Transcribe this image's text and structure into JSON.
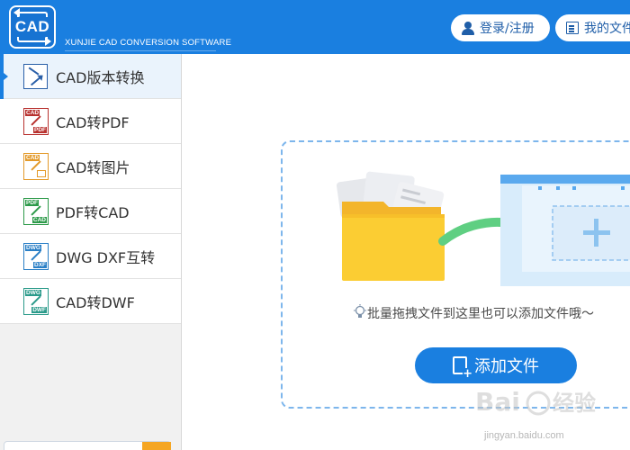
{
  "app": {
    "logo_text": "CAD",
    "tagline": "XUNJIE CAD CONVERSION SOFTWARE",
    "brand_color": "#1a7fe0"
  },
  "header": {
    "login_label": "登录/注册",
    "files_label": "我的文件"
  },
  "sidebar": {
    "items": [
      {
        "label": "CAD版本转换",
        "icon": "cad-version-convert-icon",
        "active": true
      },
      {
        "label": "CAD转PDF",
        "icon": "cad-to-pdf-icon",
        "active": false
      },
      {
        "label": "CAD转图片",
        "icon": "cad-to-image-icon",
        "active": false
      },
      {
        "label": "PDF转CAD",
        "icon": "pdf-to-cad-icon",
        "active": false
      },
      {
        "label": "DWG DXF互转",
        "icon": "dwg-dxf-convert-icon",
        "active": false
      },
      {
        "label": "CAD转DWF",
        "icon": "cad-to-dwf-icon",
        "active": false
      }
    ],
    "icon_tags": {
      "cad": "CAD",
      "pdf": "PDF",
      "dwg": "DWG",
      "dxf": "DXF",
      "dwf": "DWF"
    }
  },
  "main": {
    "drop_hint": "批量拖拽文件到这里也可以添加文件哦～",
    "add_button_label": "添加文件"
  },
  "watermark": {
    "text": "jingyan.baidu.com"
  }
}
